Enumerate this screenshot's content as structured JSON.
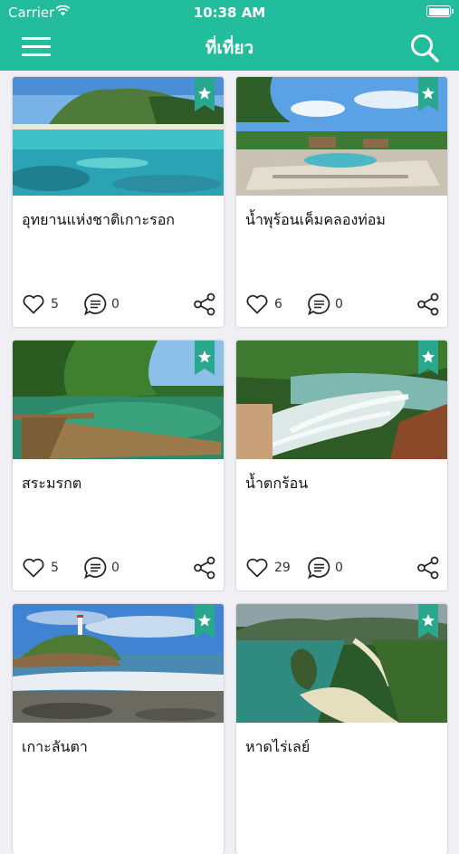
{
  "status_bar": {
    "carrier": "Carrier",
    "time": "10:38 AM"
  },
  "header": {
    "title": "ที่เที่ยว",
    "menu_icon": "hamburger-menu-icon",
    "search_icon": "search-icon"
  },
  "colors": {
    "accent": "#22bd9c",
    "bookmark": "#2aa88e"
  },
  "places": [
    {
      "name": "อุทยานแห่งชาติเกาะรอก",
      "likes": "5",
      "comments": "0"
    },
    {
      "name": "น้ำพุร้อนเค็มคลองท่อม",
      "likes": "6",
      "comments": "0"
    },
    {
      "name": "สระมรกต",
      "likes": "5",
      "comments": "0"
    },
    {
      "name": "น้ำตกร้อน",
      "likes": "29",
      "comments": "0"
    },
    {
      "name": "เกาะลันตา",
      "likes": "",
      "comments": ""
    },
    {
      "name": "หาดไร่เลย์",
      "likes": "",
      "comments": ""
    }
  ]
}
